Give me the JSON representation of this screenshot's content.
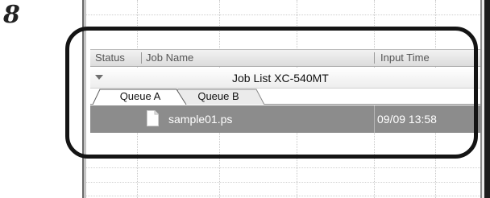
{
  "step": {
    "number": "8"
  },
  "job_list": {
    "columns": [
      "Status",
      "Job Name",
      "Input Time"
    ],
    "group_title": "Job List XC-540MT",
    "tabs": [
      {
        "label": "Queue A",
        "selected": true
      },
      {
        "label": "Queue B",
        "selected": false
      }
    ],
    "selected_job": {
      "name": "sample01.ps",
      "input_time": "09/09 13:58"
    }
  },
  "colors": {
    "selection": "#8c8c8c",
    "highlight": "#141414"
  },
  "icons": {
    "collapse": "triangle-down-icon",
    "file": "document-icon"
  }
}
